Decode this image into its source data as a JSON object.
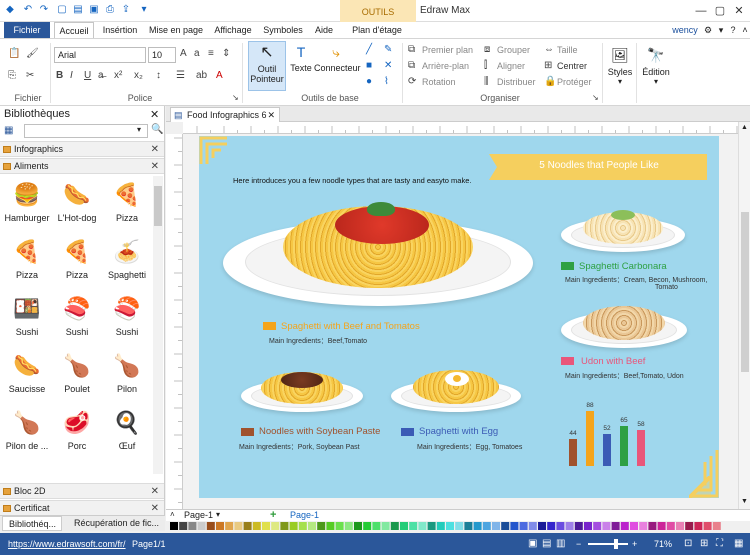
{
  "titlebar": {
    "contextual_tab": "OUTILS DOCUME...",
    "app_title": "Edraw Max"
  },
  "tabs": {
    "fichier": "Fichier",
    "items": [
      "Accueil",
      "Insértion",
      "Mise en page",
      "Affichage",
      "Symboles",
      "Aide",
      "Plan d'étage"
    ],
    "user": "wency"
  },
  "ribbon": {
    "font_name": "Arial",
    "font_size": "10",
    "groups": {
      "fichier": "Fichier",
      "police": "Police",
      "outils": "Outils de base",
      "organiser": "Organiser"
    },
    "tools": {
      "pointer": "Outil Pointeur",
      "text": "Texte",
      "connector": "Connecteur"
    },
    "arrange": {
      "front": "Premier plan",
      "back": "Arrière-plan",
      "rotate": "Rotation",
      "group": "Grouper",
      "align": "Aligner",
      "distribute": "Distribuer",
      "size": "Taille",
      "center": "Centrer",
      "protect": "Protéger"
    },
    "styles": "Styles",
    "edition": "Édition"
  },
  "sidebar": {
    "title": "Bibliothèques",
    "search_placeholder": "",
    "sections": {
      "infographics": "Infographics",
      "aliments": "Aliments",
      "bloc2d": "Bloc 2D",
      "certificat": "Certificat"
    },
    "foods": [
      {
        "label": "Hamburger",
        "glyph": "🍔"
      },
      {
        "label": "L'Hot-dog",
        "glyph": "🌭"
      },
      {
        "label": "Pizza",
        "glyph": "🍕"
      },
      {
        "label": "Pizza",
        "glyph": "🍕"
      },
      {
        "label": "Pizza",
        "glyph": "🍕"
      },
      {
        "label": "Spaghetti",
        "glyph": "🍝"
      },
      {
        "label": "Sushi",
        "glyph": "🍱"
      },
      {
        "label": "Sushi",
        "glyph": "🍣"
      },
      {
        "label": "Sushi",
        "glyph": "🍣"
      },
      {
        "label": "Saucisse",
        "glyph": "🌭"
      },
      {
        "label": "Poulet",
        "glyph": "🍗"
      },
      {
        "label": "Pilon",
        "glyph": "🍗"
      },
      {
        "label": "Pilon de ...",
        "glyph": "🍗"
      },
      {
        "label": "Porc",
        "glyph": "🥩"
      },
      {
        "label": "Œuf",
        "glyph": "🍳"
      }
    ],
    "bottom_tabs": [
      "Bibliothéq...",
      "Récupération de fic..."
    ]
  },
  "document": {
    "tab": "Food Infographics 6"
  },
  "infographic": {
    "title": "5 Noodles that People Like",
    "intro": "Here introduces you a few noodle types that are tasty and easyto make.",
    "items": [
      {
        "name": "Spaghetti with Beef and Tomatos",
        "ingredients": "Main Ingredients：Beef,Tomato",
        "color": "#f4a41b"
      },
      {
        "name": "Spaghetti Carbonara",
        "ingredients": "Main Ingredients：Cream, Becon, Mushroom,",
        "ingredients2": "Tomato",
        "color": "#2ea043"
      },
      {
        "name": "Udon with Beef",
        "ingredients": "Main Ingredients：Beef,Tomato, Udon",
        "color": "#e9567a"
      },
      {
        "name": "Noodles with Soybean Paste",
        "ingredients": "Main Ingredients：Pork, Soybean Past",
        "color": "#a0522d"
      },
      {
        "name": "Spaghetti with Egg",
        "ingredients": "Main Ingredients：Egg, Tomatoes",
        "color": "#3b5bb5"
      }
    ]
  },
  "chart_data": {
    "type": "bar",
    "values": [
      44,
      88,
      52,
      65,
      58
    ],
    "colors": [
      "#a0522d",
      "#f4a41b",
      "#3b5bb5",
      "#2ea043",
      "#e9567a"
    ],
    "ylim": [
      0,
      100
    ]
  },
  "pages": {
    "label1": "Page-1",
    "label2": "Page-1",
    "add": "+"
  },
  "status": {
    "url": "https://www.edrawsoft.com/fr/",
    "page": "Page1/1",
    "zoom": "71%"
  }
}
